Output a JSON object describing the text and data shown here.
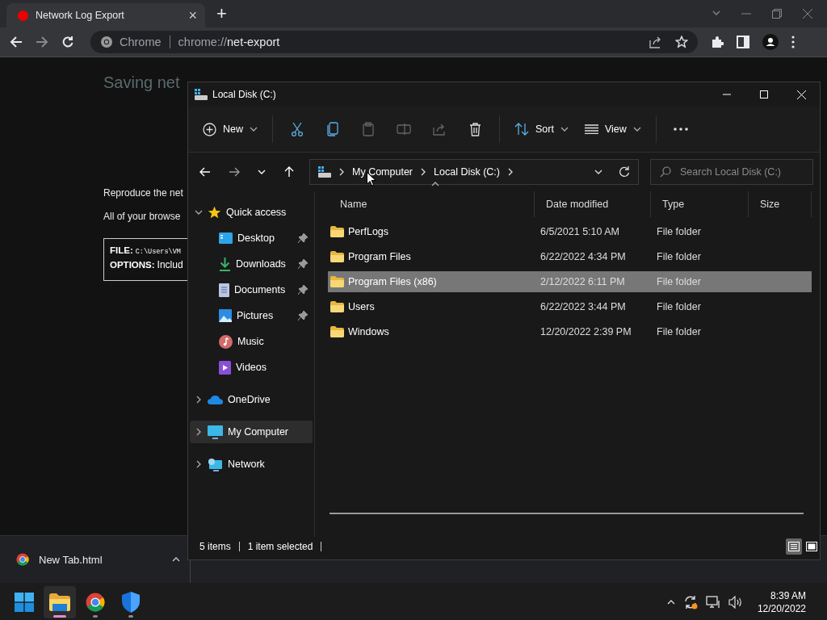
{
  "browser": {
    "tab": {
      "title": "Network Log Export",
      "close": "×"
    },
    "new_tab": "+",
    "address": {
      "site": "Chrome",
      "scheme": "chrome://",
      "path": "net-export"
    }
  },
  "page": {
    "heading": "Saving net",
    "lines": [
      "Reproduce the net",
      "All of your browse"
    ],
    "file_label": "FILE:",
    "file_path": "C:\\Users\\VM",
    "options_label": "OPTIONS:",
    "options_value": "Includ"
  },
  "explorer": {
    "title": "Local Disk (C:)",
    "commands": [
      {
        "kind": "new",
        "label": "New",
        "disabled": false
      },
      {
        "kind": "cut",
        "disabled": false
      },
      {
        "kind": "copy",
        "disabled": false
      },
      {
        "kind": "paste",
        "disabled": true
      },
      {
        "kind": "rename",
        "disabled": true
      },
      {
        "kind": "share",
        "disabled": true
      },
      {
        "kind": "delete",
        "disabled": false
      },
      {
        "kind": "sort",
        "label": "Sort",
        "disabled": false
      },
      {
        "kind": "view",
        "label": "View",
        "disabled": false
      },
      {
        "kind": "more",
        "disabled": false
      }
    ],
    "breadcrumb": [
      "My Computer",
      "Local Disk (C:)"
    ],
    "search": {
      "placeholder": "Search Local Disk (C:)"
    },
    "nav": [
      {
        "kind": "star",
        "label": "Quick access",
        "expanded": true,
        "selected": false,
        "children": [
          {
            "kind": "desktop",
            "label": "Desktop",
            "pinned": true,
            "selected": false
          },
          {
            "kind": "downloads",
            "label": "Downloads",
            "pinned": true,
            "selected": false
          },
          {
            "kind": "documents",
            "label": "Documents",
            "pinned": true,
            "selected": false
          },
          {
            "kind": "pictures",
            "label": "Pictures",
            "pinned": true,
            "selected": false
          },
          {
            "kind": "music",
            "label": "Music",
            "pinned": false,
            "selected": false
          },
          {
            "kind": "videos",
            "label": "Videos",
            "pinned": false,
            "selected": false
          }
        ]
      },
      {
        "kind": "cloud",
        "label": "OneDrive",
        "expanded": false,
        "selected": false
      },
      {
        "kind": "computer",
        "label": "My Computer",
        "expanded": false,
        "selected": true
      },
      {
        "kind": "network",
        "label": "Network",
        "expanded": false,
        "selected": false
      }
    ],
    "columns": [
      "Name",
      "Date modified",
      "Type",
      "Size"
    ],
    "rows": [
      {
        "name": "PerfLogs",
        "date": "6/5/2021 5:10 AM",
        "type": "File folder",
        "selected": false
      },
      {
        "name": "Program Files",
        "date": "6/22/2022 4:34 PM",
        "type": "File folder",
        "selected": false
      },
      {
        "name": "Program Files (x86)",
        "date": "2/12/2022 6:11 PM",
        "type": "File folder",
        "selected": true
      },
      {
        "name": "Users",
        "date": "6/22/2022 3:44 PM",
        "type": "File folder",
        "selected": false
      },
      {
        "name": "Windows",
        "date": "12/20/2022 2:39 PM",
        "type": "File folder",
        "selected": false
      }
    ],
    "status": {
      "count": "5 items",
      "selection": "1 item selected",
      "views": [
        {
          "kind": "details",
          "selected": true
        },
        {
          "kind": "tiles",
          "selected": false
        }
      ]
    }
  },
  "download_bar": {
    "file": "New Tab.html"
  },
  "taskbar": {
    "apps": [
      {
        "kind": "start",
        "active": false,
        "running": false
      },
      {
        "kind": "explorer",
        "active": true,
        "running": true
      },
      {
        "kind": "chrome",
        "active": false,
        "running": true
      },
      {
        "kind": "defender",
        "active": false,
        "running": true
      }
    ],
    "time": "8:39 AM",
    "date": "12/20/2022"
  }
}
